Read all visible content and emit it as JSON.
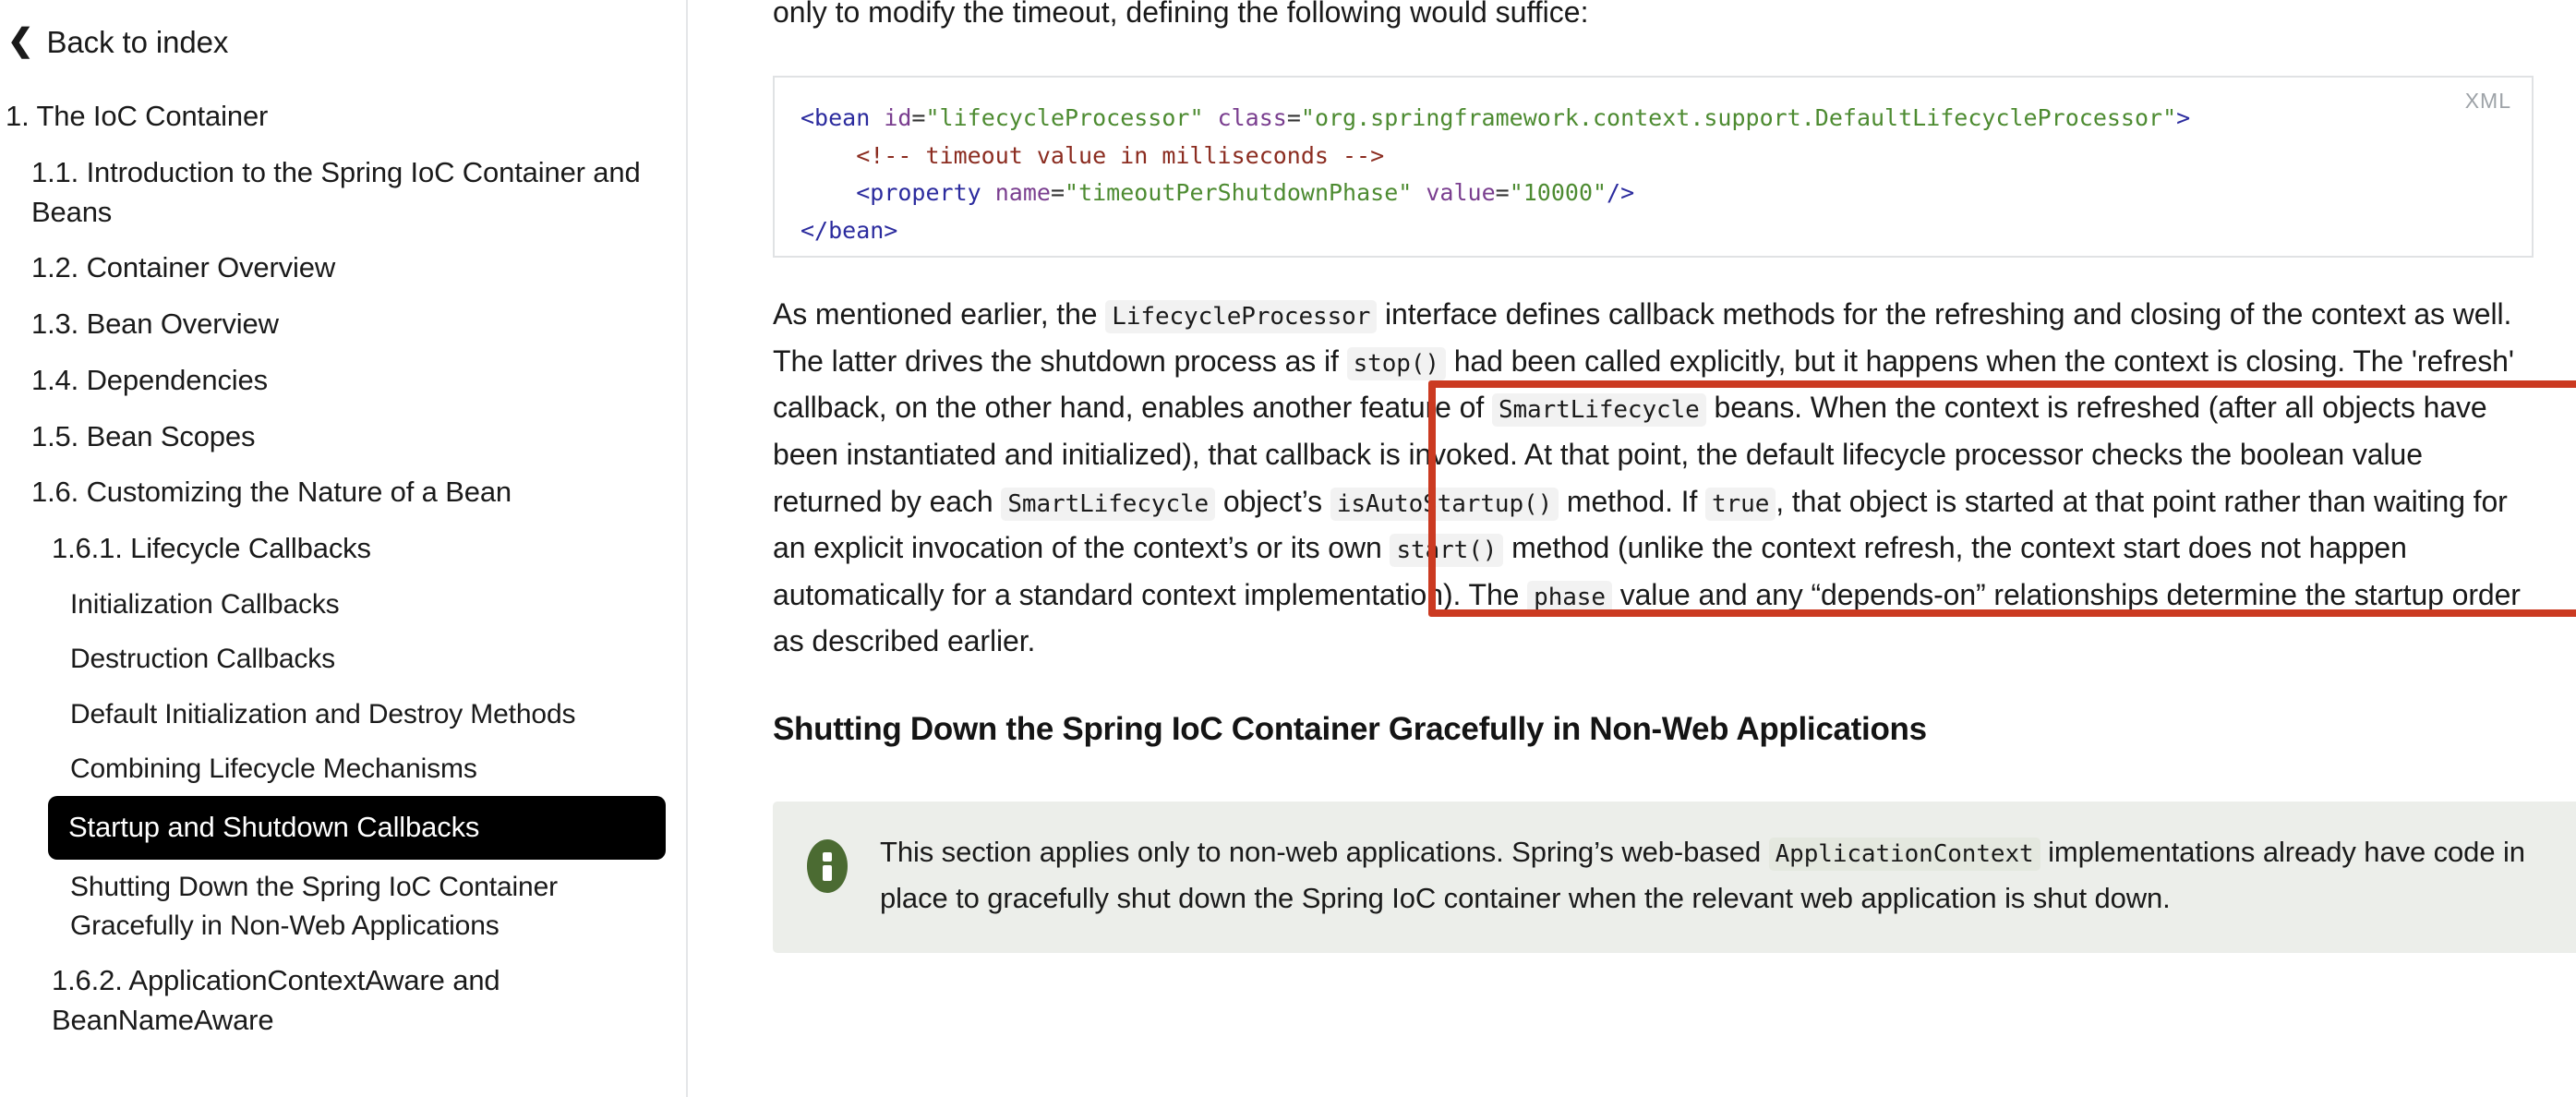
{
  "sidebar": {
    "back_link": {
      "label": "Back to index",
      "icon": "chevron-left-icon"
    },
    "items": [
      {
        "label": "1. The IoC Container",
        "level": 1,
        "current": false
      },
      {
        "label": "1.1. Introduction to the Spring IoC Container and Beans",
        "level": 2,
        "current": false
      },
      {
        "label": "1.2. Container Overview",
        "level": 2,
        "current": false
      },
      {
        "label": "1.3. Bean Overview",
        "level": 2,
        "current": false
      },
      {
        "label": "1.4. Dependencies",
        "level": 2,
        "current": false
      },
      {
        "label": "1.5. Bean Scopes",
        "level": 2,
        "current": false
      },
      {
        "label": "1.6. Customizing the Nature of a Bean",
        "level": 2,
        "current": false
      },
      {
        "label": "1.6.1. Lifecycle Callbacks",
        "level": 3,
        "current": false
      },
      {
        "label": "Initialization Callbacks",
        "level": 4,
        "current": false
      },
      {
        "label": "Destruction Callbacks",
        "level": 4,
        "current": false
      },
      {
        "label": "Default Initialization and Destroy Methods",
        "level": 4,
        "current": false
      },
      {
        "label": "Combining Lifecycle Mechanisms",
        "level": 4,
        "current": false
      },
      {
        "label": "Startup and Shutdown Callbacks",
        "level": 4,
        "current": true
      },
      {
        "label": "Shutting Down the Spring IoC Container Gracefully in Non-Web Applications",
        "level": 4,
        "current": false
      },
      {
        "label": "1.6.2. ApplicationContextAware and BeanNameAware",
        "level": 3,
        "current": false
      }
    ]
  },
  "content": {
    "lead_line": "only to modify the timeout, defining the following would suffice:",
    "listing": {
      "language_label": "XML",
      "lines": [
        {
          "segments": [
            {
              "t": "<bean",
              "c": "tag"
            },
            {
              "t": " id",
              "c": "attr"
            },
            {
              "t": "=",
              "c": "punc"
            },
            {
              "t": "\"lifecycleProcessor\"",
              "c": "str"
            },
            {
              "t": " class",
              "c": "attr"
            },
            {
              "t": "=",
              "c": "punc"
            },
            {
              "t": "\"org.springframework.context.support.DefaultLifecycleProcessor\"",
              "c": "str"
            },
            {
              "t": ">",
              "c": "tag"
            }
          ]
        },
        {
          "segments": [
            {
              "t": "    <!-- timeout value in milliseconds -->",
              "c": "cmt"
            }
          ]
        },
        {
          "segments": [
            {
              "t": "    ",
              "c": "punc"
            },
            {
              "t": "<property",
              "c": "tag"
            },
            {
              "t": " name",
              "c": "attr"
            },
            {
              "t": "=",
              "c": "punc"
            },
            {
              "t": "\"timeoutPerShutdownPhase\"",
              "c": "str"
            },
            {
              "t": " value",
              "c": "attr"
            },
            {
              "t": "=",
              "c": "punc"
            },
            {
              "t": "\"10000\"",
              "c": "str"
            },
            {
              "t": "/>",
              "c": "tag"
            }
          ]
        },
        {
          "segments": [
            {
              "t": "</bean>",
              "c": "tag"
            }
          ]
        }
      ]
    },
    "paragraph": {
      "p1": "As mentioned earlier, the ",
      "code1": "LifecycleProcessor",
      "p2": " interface defines callback methods for the refreshing and closing of the context as well. The latter drives the shutdown process as if ",
      "code2": "stop()",
      "p3": " had been called explicitly, but it happens when the context is closing. The 'refresh' callback, on the other hand, enables another feature of ",
      "code3": "SmartLifecycle",
      "p4": " beans. When the context is refreshed (after all objects have been instantiated and initialized), that callback is invoked. At that point, the default lifecycle processor checks the boolean value returned by each ",
      "code4": "SmartLifecycle",
      "p5": " object’s ",
      "code5": "isAutoStartup()",
      "p6": " method. If ",
      "code6": "true",
      "p7": ", that object is started at that point rather than waiting for an explicit invocation of the context’s or its own ",
      "code7": "start()",
      "p8": " method (unlike the context refresh, the context start does not happen automatically for a standard context implementation). The ",
      "code8": "phase",
      "p9": " value and any “depends-on” relationships determine the startup order as described earlier."
    },
    "section_title": "Shutting Down the Spring IoC Container Gracefully in Non-Web Applications",
    "note": {
      "icon": "info-icon",
      "icon_color": "#4b6b32",
      "t1": "This section applies only to non-web applications. Spring’s web-based ",
      "code1": "ApplicationContext",
      "t2": " implementations already have code in place to gracefully shut down the Spring IoC container when the relevant web application is shut down."
    }
  },
  "annotation": {
    "box_color": "#cb3a21",
    "label": "highlight-rectangle"
  }
}
